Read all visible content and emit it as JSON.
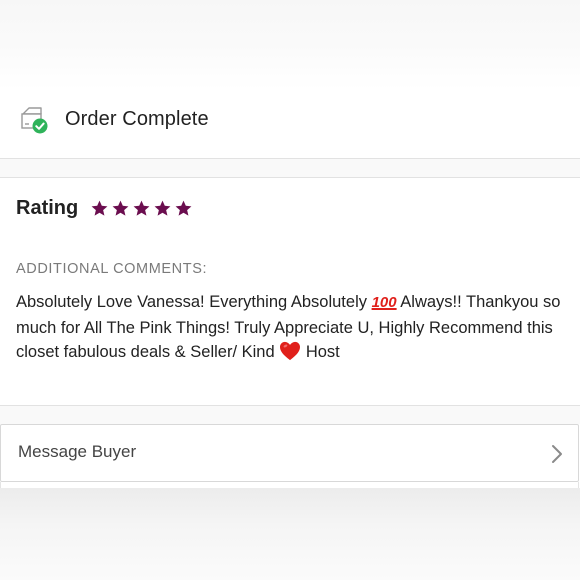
{
  "order": {
    "title": "Order Complete",
    "icon": "package-check-icon",
    "check_color": "#2fb35a"
  },
  "rating": {
    "label": "Rating",
    "stars": 5,
    "max_stars": 5,
    "star_color": "#6b0e4f"
  },
  "comments": {
    "heading": "ADDITIONAL COMMENTS:",
    "text_part1": "Absolutely Love Vanessa! Everything Absolutely ",
    "emoji_100": "100",
    "text_part2": " Always!! Thankyou so much for All The Pink Things! Truly Appreciate U, Highly Recommend this closet fabulous deals & Seller/ Kind ",
    "text_part3": " Host"
  },
  "message": {
    "label": "Message Buyer",
    "icon": "chevron-right-icon"
  }
}
